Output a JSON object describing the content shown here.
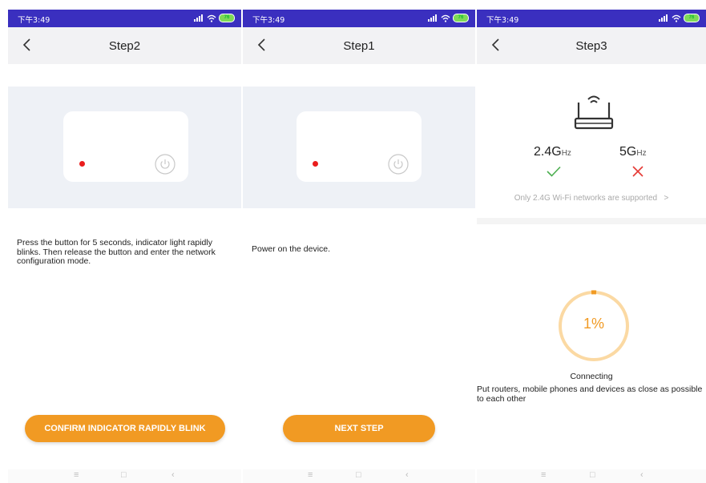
{
  "status": {
    "time": "下午3:49",
    "battery": "76"
  },
  "screens": [
    {
      "title": "Step2",
      "description": "Press the button for 5 seconds, indicator light rapidly blinks. Then release the button and enter the network configuration mode.",
      "button": "CONFIRM INDICATOR RAPIDLY BLINK"
    },
    {
      "title": "Step1",
      "description": "Power on the device.",
      "button": "NEXT STEP"
    },
    {
      "title": "Step3",
      "band_24": "2.4G",
      "band_5": "5G",
      "band_unit": "Hz",
      "support_text": "Only 2.4G Wi-Fi networks are supported",
      "progress_percent": 1,
      "progress_label": "1%",
      "status_text": "Connecting",
      "tip": "Put routers, mobile phones and devices as close as possible to each other"
    }
  ],
  "colors": {
    "statusbar": "#3a2fbf",
    "accent": "#f19a23",
    "indicator": "#ea1d1d",
    "check": "#4caf50",
    "cross": "#e53935"
  },
  "icons": [
    "back-arrow-icon",
    "power-icon",
    "router-icon",
    "check-icon",
    "cross-icon",
    "chevron-right-icon",
    "menu-icon",
    "home-icon",
    "nav-back-icon"
  ]
}
